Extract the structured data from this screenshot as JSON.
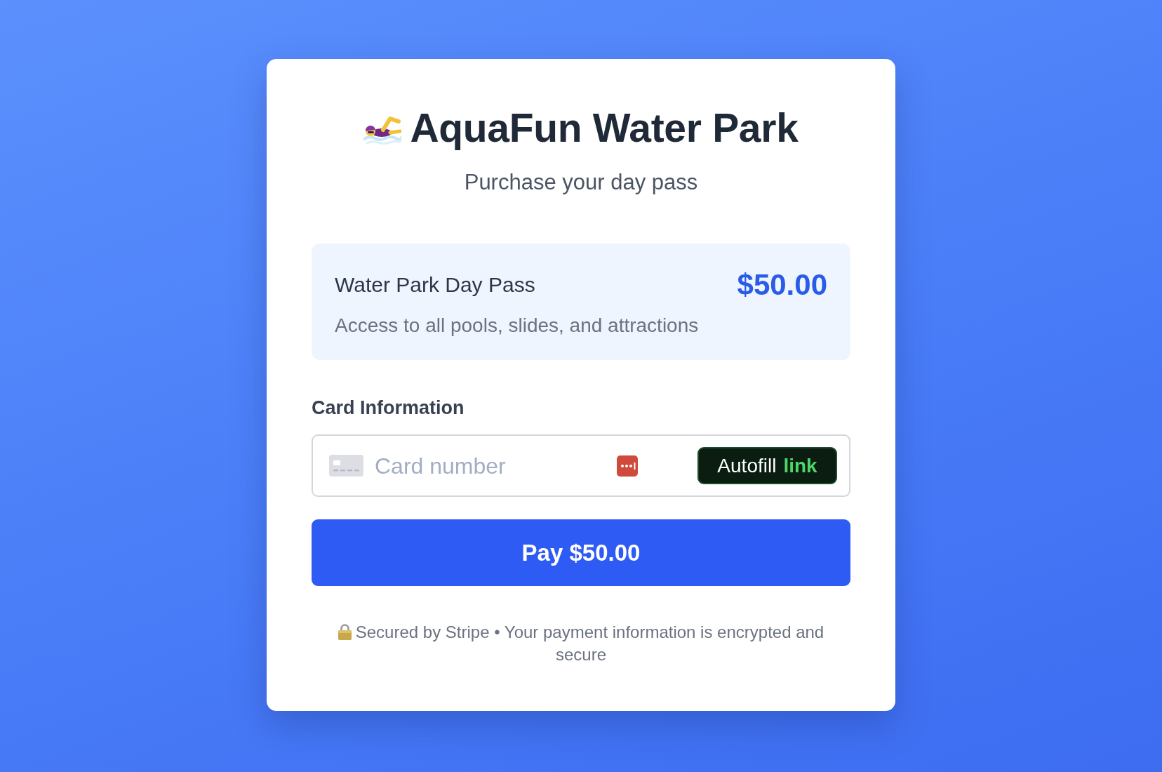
{
  "header": {
    "title": "AquaFun Water Park",
    "subtitle": "Purchase your day pass"
  },
  "product": {
    "name": "Water Park Day Pass",
    "price": "$50.00",
    "description": "Access to all pools, slides, and attractions"
  },
  "card_section": {
    "label": "Card Information",
    "card_number": {
      "placeholder": "Card number"
    },
    "autofill_button": {
      "label": "Autofill",
      "brand": "link"
    }
  },
  "pay_button": {
    "label": "Pay $50.00"
  },
  "footer": {
    "text": "Secured by Stripe • Your payment information is encrypted and secure"
  }
}
